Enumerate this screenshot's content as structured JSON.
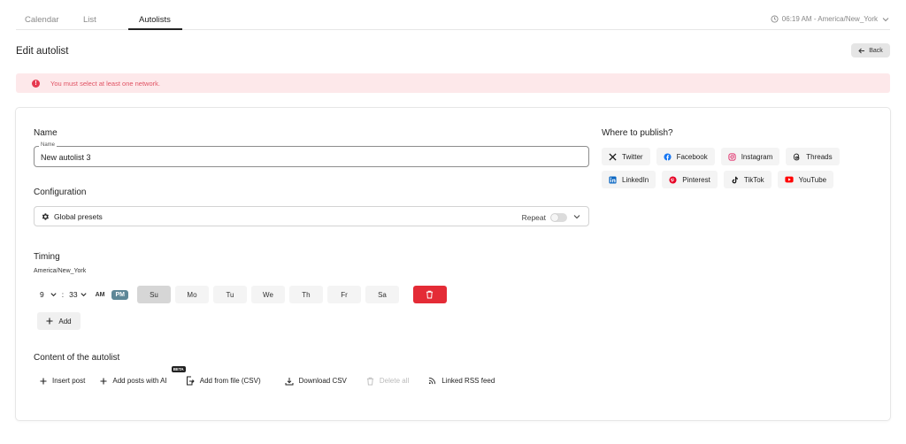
{
  "tabs": [
    {
      "label": "Calendar",
      "active": false
    },
    {
      "label": "List",
      "active": false
    },
    {
      "label": "Autolists",
      "active": true
    }
  ],
  "timezone_display": "06:19 AM - America/New_York",
  "page": {
    "title": "Edit autolist",
    "back_label": "Back"
  },
  "alert": {
    "message": "You must select at least one network.",
    "color": "#e05263"
  },
  "form": {
    "name_title": "Name",
    "name_legend": "Name",
    "name_value": "New autolist 3",
    "config_title": "Configuration",
    "config_value": "Global presets",
    "repeat_label": "Repeat",
    "repeat_on": false,
    "timing_title": "Timing",
    "timing_timezone": "America/New_York",
    "hour": "9",
    "separator": ":",
    "minute": "33",
    "am_label": "AM",
    "pm_label": "PM",
    "period_selected": "PM",
    "days": [
      {
        "label": "Su",
        "selected": true
      },
      {
        "label": "Mo",
        "selected": false
      },
      {
        "label": "Tu",
        "selected": false
      },
      {
        "label": "We",
        "selected": false
      },
      {
        "label": "Th",
        "selected": false
      },
      {
        "label": "Fr",
        "selected": false
      },
      {
        "label": "Sa",
        "selected": false
      }
    ],
    "add_label": "Add",
    "content_title": "Content of the autolist",
    "content_actions": [
      {
        "label": "Insert post",
        "icon": "plus-icon",
        "disabled": false
      },
      {
        "label": "Add posts with AI",
        "icon": "plus-icon",
        "disabled": false
      },
      {
        "label": "Add from file (CSV)",
        "icon": "file-import-icon",
        "disabled": false,
        "badge": "BETA"
      },
      {
        "label": "Download CSV",
        "icon": "download-icon",
        "disabled": false
      },
      {
        "label": "Delete all",
        "icon": "trash-icon",
        "disabled": true
      },
      {
        "label": "Linked RSS feed",
        "icon": "rss-icon",
        "disabled": false
      }
    ]
  },
  "publish": {
    "title": "Where to publish?",
    "networks": [
      {
        "label": "Twitter",
        "icon": "x-twitter-icon",
        "color": "#111111"
      },
      {
        "label": "Facebook",
        "icon": "facebook-icon",
        "color": "#1877f2"
      },
      {
        "label": "Instagram",
        "icon": "instagram-icon",
        "color": "#e1306c"
      },
      {
        "label": "Threads",
        "icon": "threads-icon",
        "color": "#111111"
      },
      {
        "label": "LinkedIn",
        "icon": "linkedin-icon",
        "color": "#0a66c2"
      },
      {
        "label": "Pinterest",
        "icon": "pinterest-icon",
        "color": "#e60023"
      },
      {
        "label": "TikTok",
        "icon": "tiktok-icon",
        "color": "#111111"
      },
      {
        "label": "YouTube",
        "icon": "youtube-icon",
        "color": "#ff0000"
      }
    ]
  },
  "colors": {
    "accent_pm": "#5e8797",
    "delete_red": "#e42b36",
    "alert_bg": "#fde8ea"
  }
}
